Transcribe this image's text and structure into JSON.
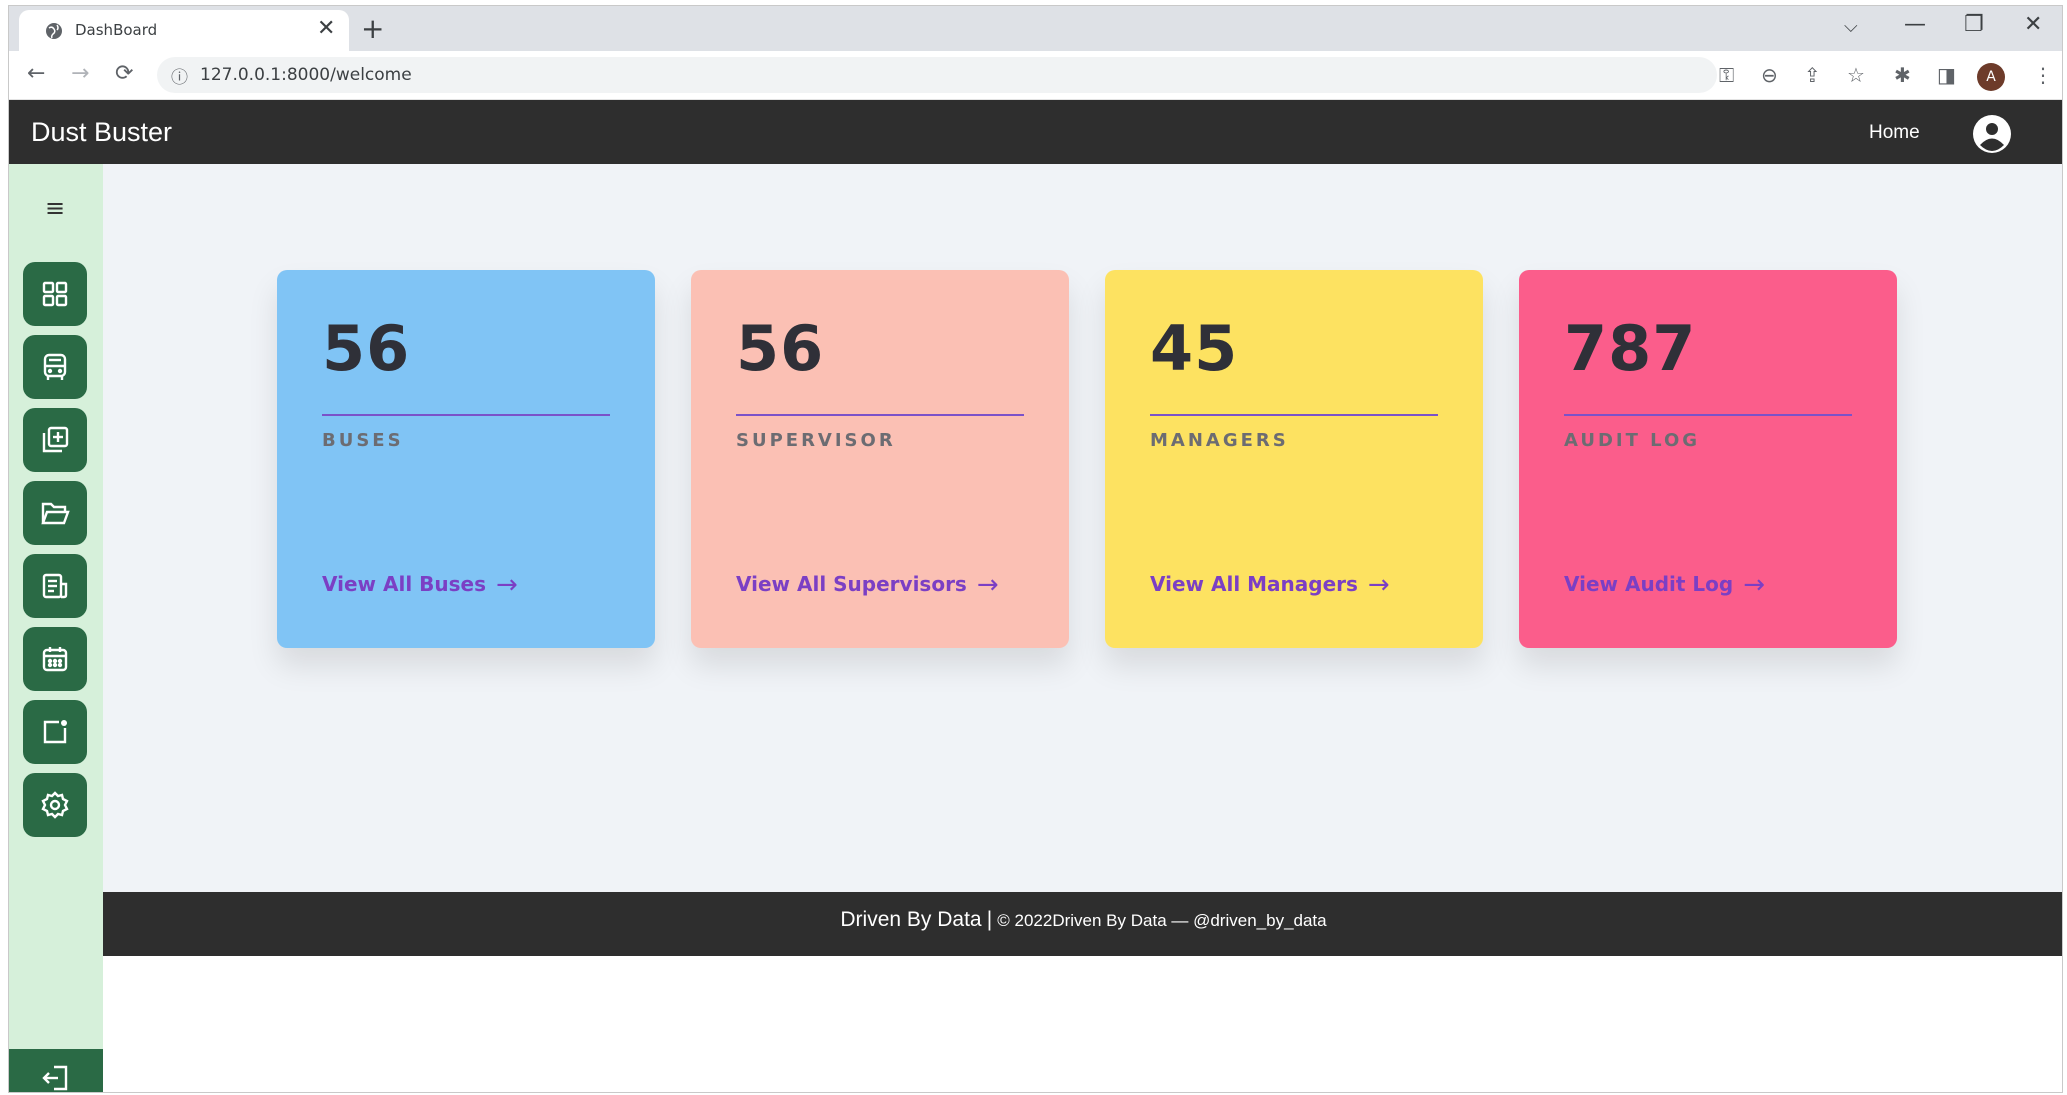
{
  "browser": {
    "tab_title": "DashBoard",
    "tab_close": "✕",
    "new_tab": "+",
    "url": "127.0.0.1:8000/welcome",
    "profile_initial": "A",
    "window_controls": {
      "collapse": "⌵",
      "minimize": "—",
      "restore": "❐",
      "close": "✕"
    }
  },
  "header": {
    "brand": "Dust Buster",
    "home_label": "Home"
  },
  "sidebar": {
    "menu_icon": "≡",
    "items": [
      {
        "icon": "dashboard-grid-icon"
      },
      {
        "icon": "bus-icon"
      },
      {
        "icon": "add-copy-icon"
      },
      {
        "icon": "folder-open-icon"
      },
      {
        "icon": "document-icon"
      },
      {
        "icon": "calendar-icon"
      },
      {
        "icon": "notification-box-icon"
      },
      {
        "icon": "settings-gear-icon"
      }
    ],
    "logout_icon": "logout-icon"
  },
  "cards": [
    {
      "count": "56",
      "label": "BUSES",
      "link": "View All Buses",
      "arrow": "→",
      "color": "#80c4f5"
    },
    {
      "count": "56",
      "label": "SUPERVISOR",
      "link": "View All Supervisors",
      "arrow": "→",
      "color": "#fbc0b4"
    },
    {
      "count": "45",
      "label": "MANAGERS",
      "link": "View All Managers",
      "arrow": "→",
      "color": "#fde261"
    },
    {
      "count": "787",
      "label": "AUDIT LOG",
      "link": "View Audit Log",
      "arrow": "→",
      "color": "#fb5d8b"
    }
  ],
  "footer": {
    "brand": "Driven By Data",
    "separator": "|",
    "copyright": "© 2022Driven By Data — @driven_by_data"
  },
  "colors": {
    "header_bg": "#2e2e2e",
    "sidebar_bg": "#d6f0da",
    "sidebar_button": "#2a6a45",
    "accent": "#7b3fc4"
  }
}
